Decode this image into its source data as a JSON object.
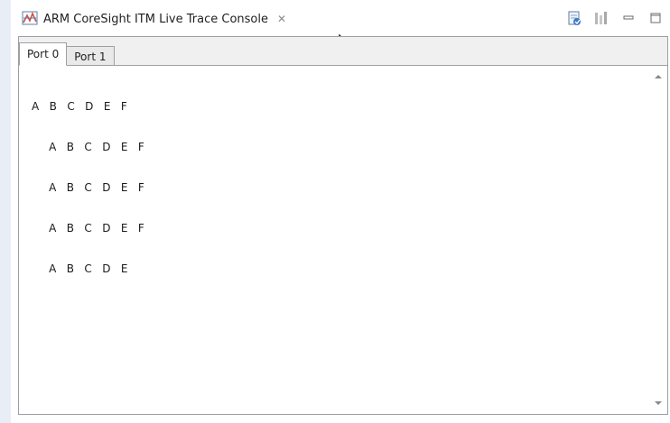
{
  "view": {
    "title": "ARM CoreSight ITM Live Trace Console",
    "close_glyph": "✕",
    "icons": [
      "trace-view-icon",
      "export-log-icon",
      "column-chart-icon",
      "minimize-icon",
      "maximize-icon"
    ]
  },
  "console": {
    "tabs": [
      {
        "label": "Port 0",
        "active": true
      },
      {
        "label": "Port 1",
        "active": false
      }
    ],
    "lines": [
      "A   B   C   D   E   F",
      "     A   B   C   D   E   F",
      "     A   B   C   D   E   F",
      "     A   B   C   D   E   F",
      "     A   B   C   D   E"
    ]
  }
}
